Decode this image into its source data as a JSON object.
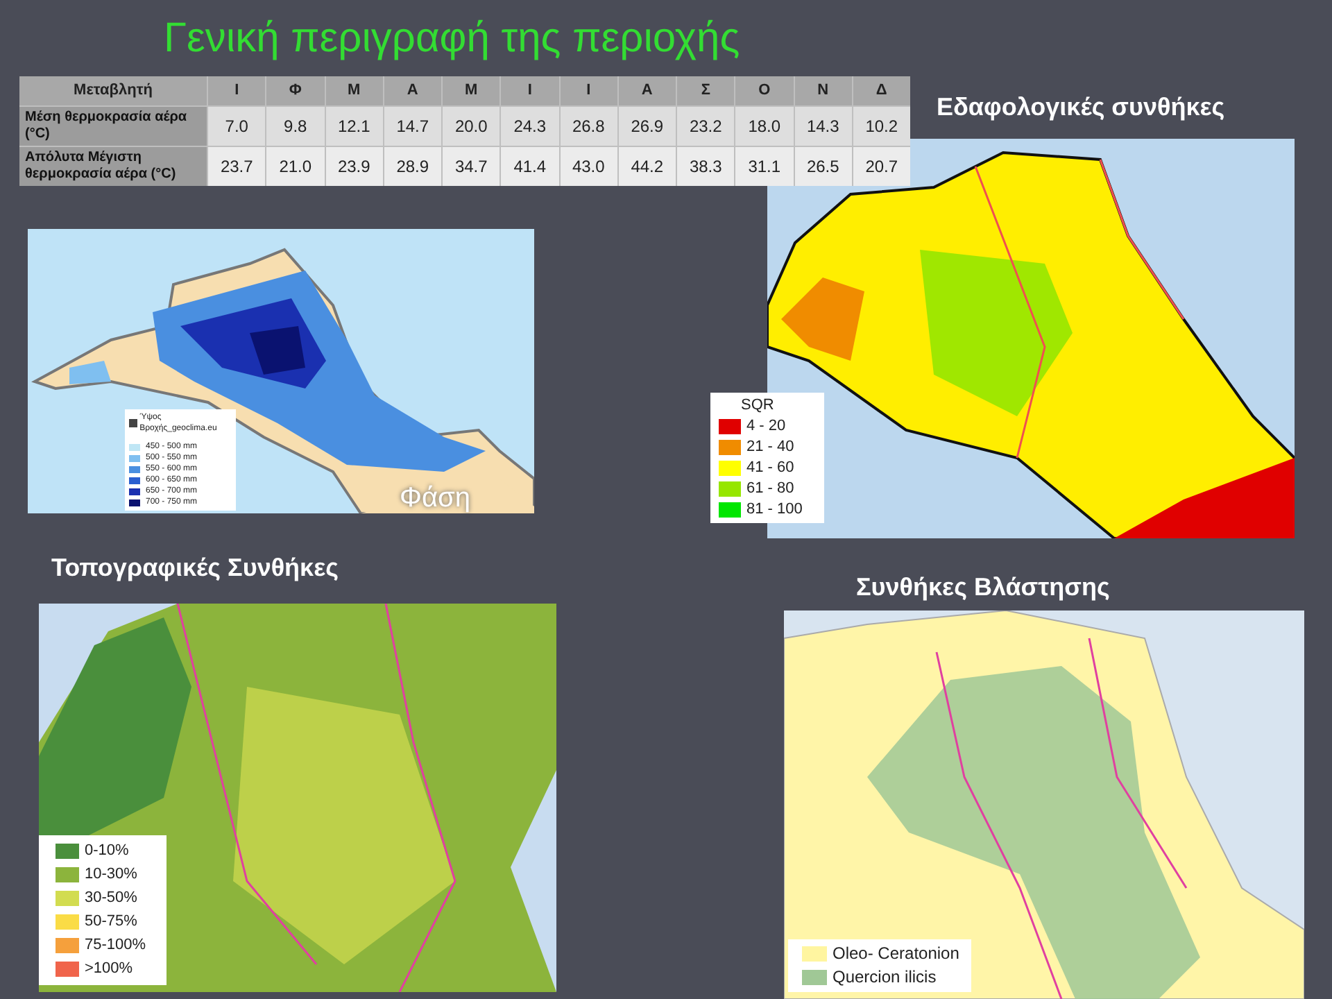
{
  "title": "Γενική περιγραφή της περιοχής",
  "table": {
    "columns": [
      "Μεταβλητή",
      "Ι",
      "Φ",
      "Μ",
      "Α",
      "Μ",
      "Ι",
      "Ι",
      "Α",
      "Σ",
      "Ο",
      "Ν",
      "Δ"
    ],
    "rows": [
      {
        "cells": [
          "Μέση θερμοκρασία αέρα (°C)",
          "7.0",
          "9.8",
          "12.1",
          "14.7",
          "20.0",
          "24.3",
          "26.8",
          "26.9",
          "23.2",
          "18.0",
          "14.3",
          "10.2"
        ]
      },
      {
        "cells": [
          "Απόλυτα Μέγιστη θερμοκρασία αέρα (°C)",
          "23.7",
          "21.0",
          "23.9",
          "28.9",
          "34.7",
          "41.4",
          "43.0",
          "44.2",
          "38.3",
          "31.1",
          "26.5",
          "20.7"
        ]
      }
    ]
  },
  "panels": [
    {
      "kind": "precipitation",
      "overlay_text": "Φάση",
      "legend": {
        "title": "Ύψος Βροχής_geoclima.eu",
        "checked": true,
        "items": [
          {
            "label": "450 - 500 mm",
            "color": "#bfe6f5"
          },
          {
            "label": "500 - 550 mm",
            "color": "#7fbff0"
          },
          {
            "label": "550 - 600 mm",
            "color": "#4a8fe0"
          },
          {
            "label": "600 - 650 mm",
            "color": "#2a5fd0"
          },
          {
            "label": "650 - 700 mm",
            "color": "#1a30b0"
          },
          {
            "label": "700 - 750 mm",
            "color": "#0a1270"
          }
        ]
      }
    },
    {
      "kind": "soil",
      "heading": "Εδαφολογικές συνθήκες",
      "legend": {
        "title": "SQR",
        "items": [
          {
            "label": "4 - 20",
            "color": "#e00000"
          },
          {
            "label": "21 - 40",
            "color": "#f08c00"
          },
          {
            "label": "41 - 60",
            "color": "#ffff00"
          },
          {
            "label": "61 - 80",
            "color": "#96e600"
          },
          {
            "label": "81 - 100",
            "color": "#00e600"
          }
        ]
      }
    },
    {
      "kind": "topography",
      "heading": "Τοπογραφικές Συνθήκες",
      "legend": {
        "items": [
          {
            "label": "0-10%",
            "color": "#4a8f3c"
          },
          {
            "label": "10-30%",
            "color": "#8cb43c"
          },
          {
            "label": "30-50%",
            "color": "#d2dc50"
          },
          {
            "label": "50-75%",
            "color": "#fadc46"
          },
          {
            "label": "75-100%",
            "color": "#f5a03c"
          },
          {
            "label": ">100%",
            "color": "#f0644b"
          }
        ]
      }
    },
    {
      "kind": "vegetation",
      "heading": "Συνθήκες Βλάστησης",
      "legend": {
        "items": [
          {
            "label": "Oleo- Ceratonion",
            "color": "#fff5a0"
          },
          {
            "label": "Quercion ilicis",
            "color": "#a0c896"
          }
        ]
      }
    }
  ]
}
